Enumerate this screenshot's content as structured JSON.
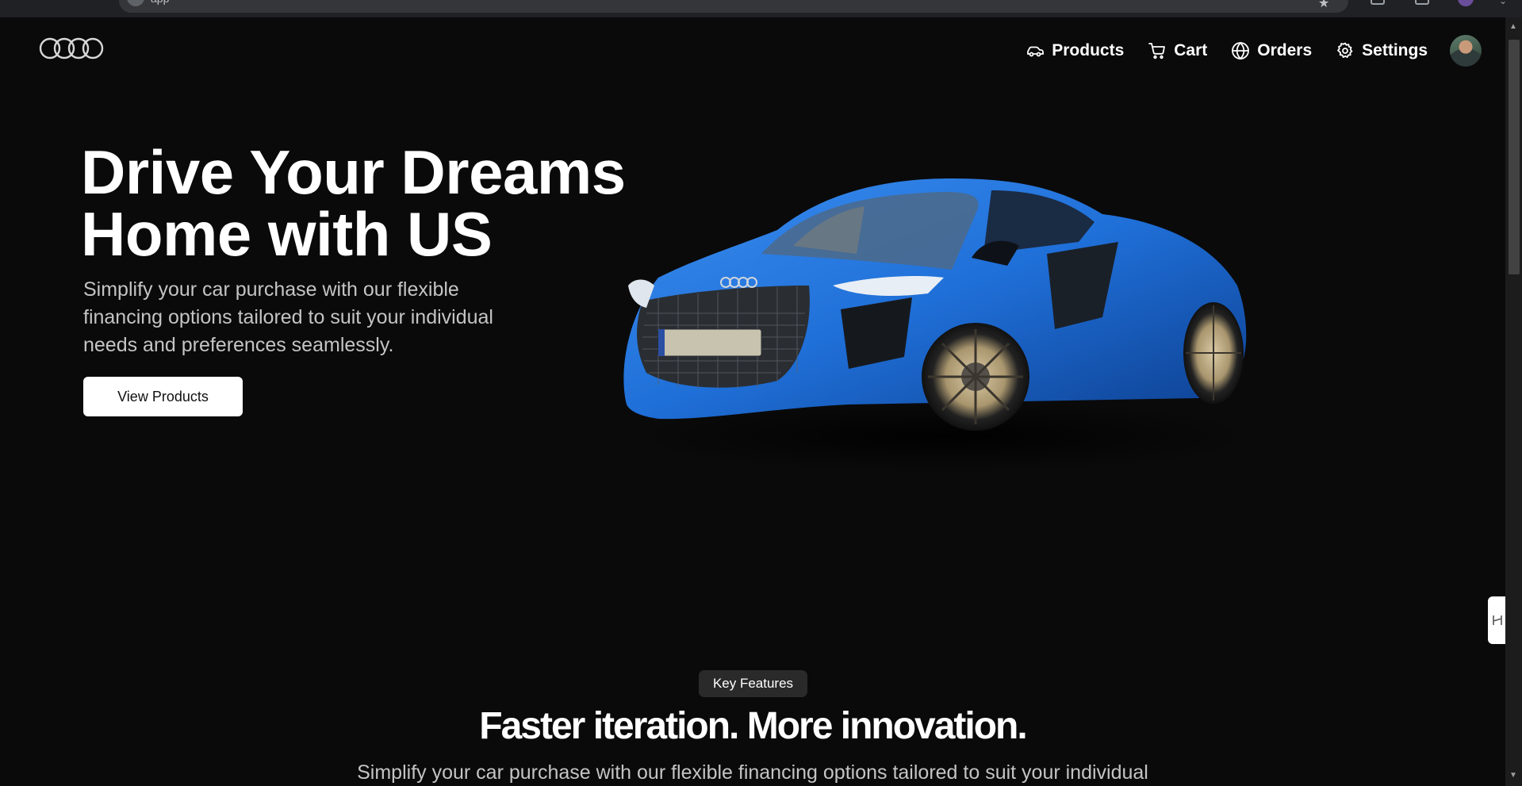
{
  "browser": {
    "address_text": "app"
  },
  "nav": {
    "items": [
      {
        "label": "Products",
        "icon": "car-icon"
      },
      {
        "label": "Cart",
        "icon": "cart-icon"
      },
      {
        "label": "Orders",
        "icon": "globe-icon"
      },
      {
        "label": "Settings",
        "icon": "gear-icon"
      }
    ]
  },
  "hero": {
    "title": "Drive Your Dreams\nHome with US",
    "subtitle": "Simplify your car purchase with our flexible financing options tailored to suit your individual needs and preferences seamlessly.",
    "button_label": "View Products"
  },
  "features": {
    "badge": "Key Features",
    "title": "Faster iteration. More innovation.",
    "subtitle": "Simplify your car purchase with our flexible financing options tailored to suit your individual"
  },
  "colors": {
    "background": "#0a0a0a",
    "text": "#ffffff",
    "muted_text": "#c4c4c4",
    "car_blue": "#1f6fd8"
  }
}
